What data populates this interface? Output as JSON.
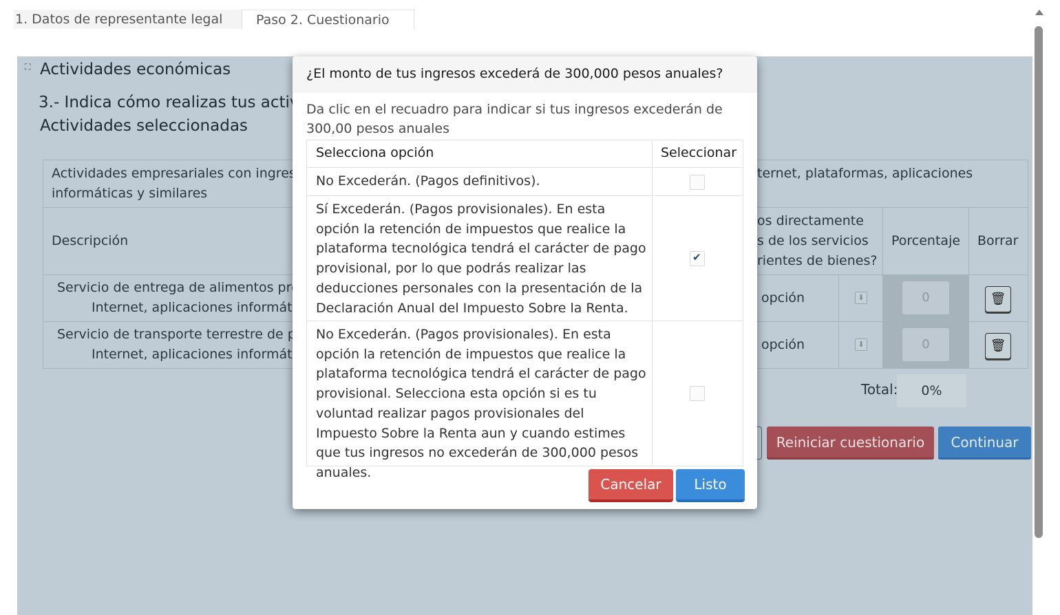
{
  "tabs": [
    {
      "label": "1. Datos de representante legal"
    },
    {
      "label": "Paso 2. Cuestionario"
    }
  ],
  "background": {
    "section_title": "Actividades económicas",
    "question_partial": "3.- Indica cómo realizas tus activi",
    "selected_heading": "Actividades seleccionadas",
    "group_header_left": "Actividades empresariales con ingreso",
    "group_header_left_2": "informáticas y similares",
    "group_header_right": "ternet, plataformas, aplicaciones",
    "col_description": "Descripción",
    "col_direct_1": "os directamente",
    "col_direct_2": "s de los servicios",
    "col_direct_3": "rientes de bienes?",
    "col_percentage": "Porcentaje",
    "col_delete": "Borrar",
    "rows": [
      {
        "line1": "Servicio de entrega de alimentos pre",
        "line2": "Internet, aplicaciones informáti",
        "option": "opción",
        "percentage": "0"
      },
      {
        "line1": "Servicio de transporte terrestre de pa",
        "line2": "Internet, aplicaciones informáti",
        "option": "opción",
        "percentage": "0"
      }
    ],
    "total_label": "Total:",
    "total_value": "0%",
    "reset_button": "Reiniciar cuestionario",
    "continue_button": "Continuar"
  },
  "modal": {
    "title": "¿El monto de tus ingresos excederá de 300,000 pesos anuales?",
    "instruction": "Da clic en el recuadro para indicar si tus ingresos excederán de 300,00 pesos anuales",
    "col_option": "Selecciona opción",
    "col_select": "Seleccionar",
    "options": [
      {
        "text": "No Excederán. (Pagos definitivos).",
        "checked": false
      },
      {
        "text": "Sí Excederán. (Pagos provisionales). En esta opción la retención de impuestos que realice la plataforma tecnológica tendrá el carácter de pago provisional, por lo que podrás realizar las deducciones personales con la presentación de la Declaración Anual del Impuesto Sobre la Renta.",
        "checked": true
      },
      {
        "text": "No Excederán. (Pagos provisionales). En esta opción la retención de impuestos que realice la plataforma tecnológica tendrá el carácter de pago provisional. Selecciona esta opción si es tu voluntad realizar pagos provisionales del Impuesto Sobre la Renta aun y cuando estimes que tus ingresos no excederán de 300,000 pesos anuales.",
        "checked": false
      }
    ],
    "cancel_button": "Cancelar",
    "done_button": "Listo"
  },
  "colors": {
    "overlay_panel": "#bfccd5",
    "cancel": "#d9534f",
    "done": "#3b8ddb",
    "reset": "#a34f55",
    "continue": "#3f7fbf"
  }
}
